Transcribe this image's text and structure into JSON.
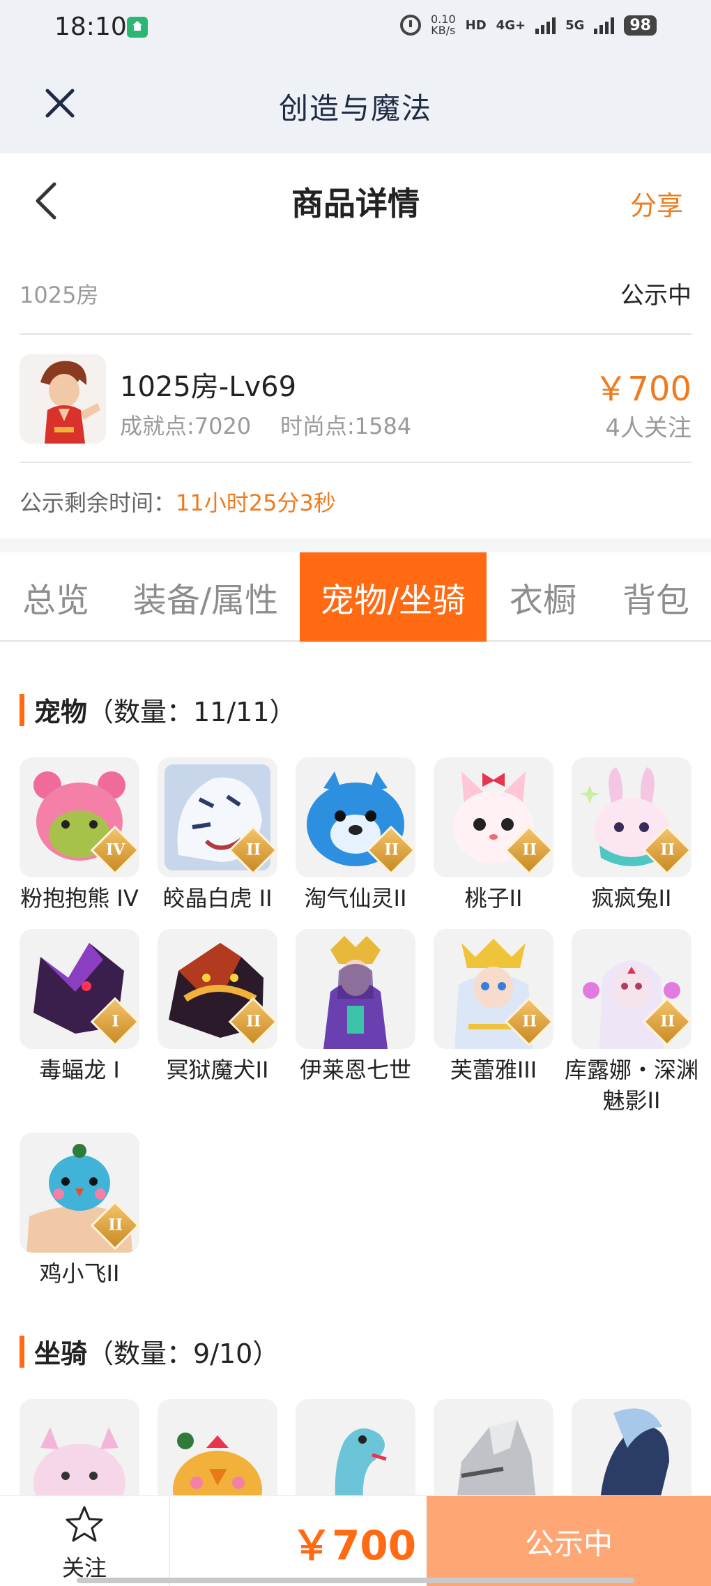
{
  "status_bar": {
    "time": "18:10",
    "net_speed": "0.10",
    "net_speed_unit": "KB/s",
    "hd_tag": "HD",
    "net_4g": "4G+",
    "net_5g": "5G",
    "battery": "98"
  },
  "app": {
    "title": "创造与魔法"
  },
  "header": {
    "title": "商品详情",
    "share_label": "分享"
  },
  "summary": {
    "room_name": "1025房",
    "status": "公示中",
    "item_title": "1025房-Lv69",
    "achievement": "成就点:7020",
    "fashion": "时尚点:1584",
    "price": "￥700",
    "followers": "4人关注",
    "countdown_label": "公示剩余时间：",
    "countdown_value": "11小时25分3秒"
  },
  "tabs": [
    {
      "label": "总览",
      "active": false
    },
    {
      "label": "装备/属性",
      "active": false
    },
    {
      "label": "宠物/坐骑",
      "active": true
    },
    {
      "label": "衣橱",
      "active": false
    },
    {
      "label": "背包",
      "active": false
    }
  ],
  "pets": {
    "title": "宠物",
    "count": "（数量：11/11）",
    "items": [
      {
        "name": "粉抱抱熊 IV",
        "rank": "IV",
        "color": "#f47fa7"
      },
      {
        "name": "皎晶白虎 II",
        "rank": "II",
        "color": "#9fb4d6"
      },
      {
        "name": "淘气仙灵II",
        "rank": "II",
        "color": "#2d8fe0"
      },
      {
        "name": "桃子II",
        "rank": "II",
        "color": "#ffc7d6"
      },
      {
        "name": "疯疯兔II",
        "rank": "II",
        "color": "#f3c6e2"
      },
      {
        "name": "毒蝠龙 I",
        "rank": "I",
        "color": "#5b2a7a"
      },
      {
        "name": "冥狱魔犬II",
        "rank": "II",
        "color": "#b23a1e"
      },
      {
        "name": "伊莱恩七世",
        "rank": "",
        "color": "#6a3fb0"
      },
      {
        "name": "芙蕾雅III",
        "rank": "II",
        "color": "#dbe6f7"
      },
      {
        "name": "库露娜・深渊魅影II",
        "rank": "II",
        "color": "#e8dcf0"
      },
      {
        "name": "鸡小飞II",
        "rank": "II",
        "color": "#42b3d8"
      }
    ]
  },
  "mounts": {
    "title": "坐骑",
    "count": "（数量：9/10）",
    "colors": [
      "#f6d7ea",
      "#f2b13b",
      "#6cc4d9",
      "#bfc3c7",
      "#2b3c66"
    ]
  },
  "bottom": {
    "follow_label": "关注",
    "price": "￥700",
    "status_button": "公示中"
  }
}
